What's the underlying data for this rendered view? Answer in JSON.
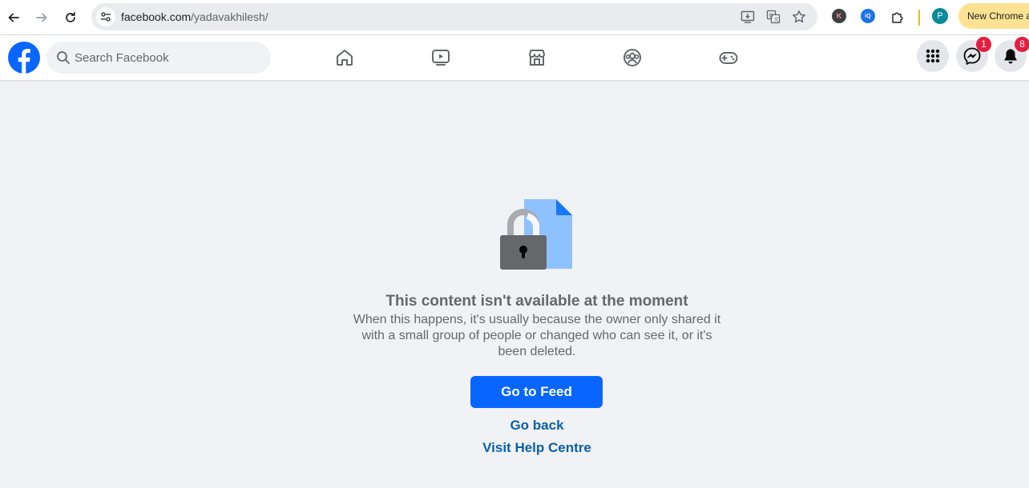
{
  "browser": {
    "url_domain": "facebook.com",
    "url_path": "/yadavakhilesh/",
    "new_chrome_label": "New Chrome a",
    "profile_initial": "P",
    "ext_k_label": "K",
    "ext_iq_label": "iQ"
  },
  "facebook": {
    "search_placeholder": "Search Facebook",
    "nav_tabs": [
      "home",
      "video",
      "marketplace",
      "groups",
      "gaming"
    ],
    "messenger_badge": "1",
    "notifications_badge": "8"
  },
  "main": {
    "title": "This content isn't available at the moment",
    "description": "When this happens, it's usually because the owner only shared it with a small group of people or changed who can see it, or it's been deleted.",
    "go_to_feed_label": "Go to Feed",
    "go_back_label": "Go back",
    "help_label": "Visit Help Centre"
  },
  "colors": {
    "fb_blue": "#0866ff",
    "link_blue": "#0a5fa8",
    "badge_red": "#e41e3f",
    "page_bg": "#f0f2f5"
  }
}
